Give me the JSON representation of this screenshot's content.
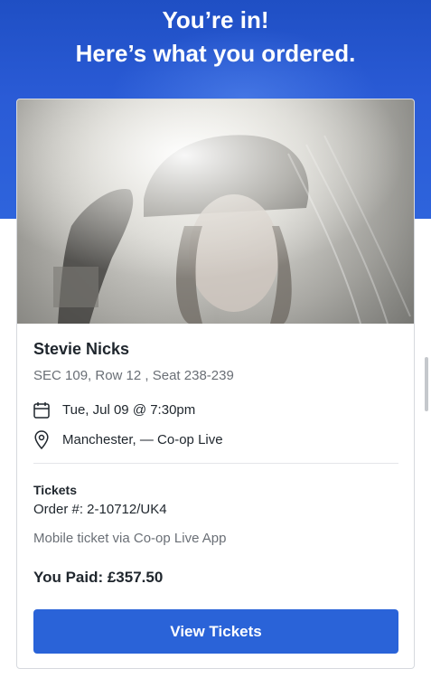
{
  "header": {
    "line1": "You’re in!",
    "line2": "Here’s what you ordered."
  },
  "event": {
    "artist": "Stevie Nicks",
    "seat": "SEC 109, Row 12 , Seat 238-239",
    "date": "Tue, Jul 09 @ 7:30pm",
    "venue": "Manchester, — Co-op Live",
    "calendar_icon": "calendar-icon",
    "location_icon": "map-pin-icon"
  },
  "order": {
    "tickets_label": "Tickets",
    "order_number": "Order #: 2-10712/UK4",
    "delivery": "Mobile ticket via Co-op Live App",
    "paid": "You Paid: £357.50"
  },
  "actions": {
    "view_tickets": "View Tickets"
  },
  "colors": {
    "header_blue": "#2a5bd6",
    "button_blue": "#2a63d8"
  }
}
